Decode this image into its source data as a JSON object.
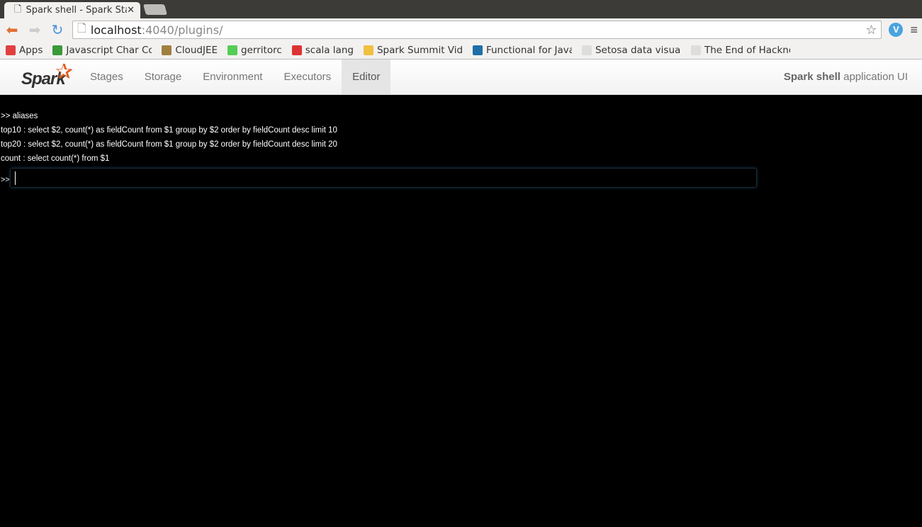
{
  "browser": {
    "tab_title": "Spark shell - Spark Stages",
    "url_host": "localhost",
    "url_path": ":4040/plugins/",
    "bookmarks": [
      {
        "label": "Apps",
        "color": "#e04040"
      },
      {
        "label": "Javascript Char Co",
        "color": "#3a9a3a"
      },
      {
        "label": "CloudJEE",
        "color": "#a08040"
      },
      {
        "label": "gerritorc",
        "color": "#5c5"
      },
      {
        "label": "scala lang",
        "color": "#d33"
      },
      {
        "label": "Spark Summit Vide",
        "color": "#f0c040"
      },
      {
        "label": "Functional for Java",
        "color": "#1f6fa8"
      },
      {
        "label": "Setosa data visuali",
        "color": "#ddd"
      },
      {
        "label": "The End of Hackno",
        "color": "#ddd"
      }
    ]
  },
  "spark": {
    "logo_text": "Spark",
    "nav": [
      {
        "label": "Stages"
      },
      {
        "label": "Storage"
      },
      {
        "label": "Environment"
      },
      {
        "label": "Executors"
      },
      {
        "label": "Editor",
        "active": true
      }
    ],
    "app_title_bold": "Spark shell",
    "app_title_rest": " application UI"
  },
  "console": {
    "lines": [
      ">> aliases",
      "top10 : select $2, count(*) as fieldCount from $1 group by $2 order by fieldCount desc limit 10",
      "top20 : select $2, count(*) as fieldCount from $1 group by $2 order by fieldCount desc limit 20",
      "count : select count(*) from $1"
    ],
    "prompt": ">>",
    "input_value": ""
  }
}
